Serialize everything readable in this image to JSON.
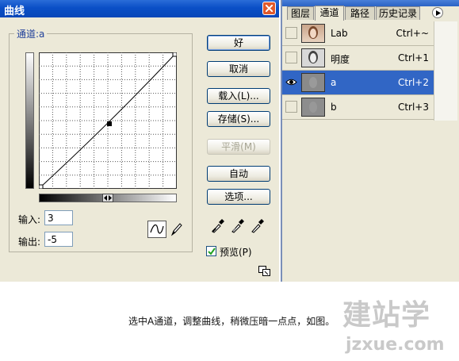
{
  "dialog": {
    "title": "曲线",
    "channel_label": "通道:a",
    "input_label": "输入:",
    "input_value": "3",
    "output_label": "输出:",
    "output_value": "-5",
    "buttons": {
      "ok": "好",
      "cancel": "取消",
      "load": "载入(L)...",
      "save": "存储(S)...",
      "smooth": "平滑(M)",
      "auto": "自动",
      "options": "选项..."
    },
    "preview_label": "预览(P)",
    "preview_checked": true
  },
  "panel": {
    "tabs": [
      "图层",
      "通道",
      "路径",
      "历史记录"
    ],
    "active_tab": "通道",
    "channels": [
      {
        "name": "Lab",
        "shortcut": "Ctrl+~",
        "visible": false,
        "selected": false
      },
      {
        "name": "明度",
        "shortcut": "Ctrl+1",
        "visible": false,
        "selected": false
      },
      {
        "name": "a",
        "shortcut": "Ctrl+2",
        "visible": true,
        "selected": true
      },
      {
        "name": "b",
        "shortcut": "Ctrl+3",
        "visible": false,
        "selected": false
      }
    ]
  },
  "caption": "选中A通道，调整曲线，稍微压暗一点点，如图。",
  "watermark": {
    "logo": "建站学",
    "url": "jzxue.com"
  },
  "colors": {
    "title_bar": "#0a4fc6",
    "selected_row": "#3166c5",
    "dialog_bg": "#ece9d8"
  }
}
